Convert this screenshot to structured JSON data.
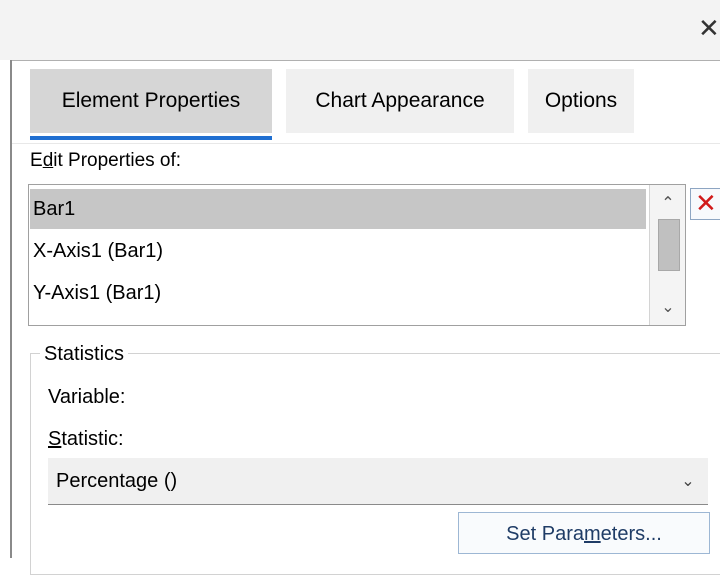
{
  "window": {
    "close_glyph": "✕"
  },
  "tabs": [
    {
      "label": "Element Properties",
      "active": true
    },
    {
      "label": "Chart Appearance",
      "active": false
    },
    {
      "label": "Options",
      "active": false
    }
  ],
  "edit_properties": {
    "label_prefix": "E",
    "label_mnemonic": "d",
    "label_suffix": "it Properties of:",
    "items": [
      {
        "label": "Bar1",
        "selected": true
      },
      {
        "label": "X-Axis1 (Bar1)",
        "selected": false
      },
      {
        "label": "Y-Axis1 (Bar1)",
        "selected": false
      }
    ],
    "delete_glyph": "✕"
  },
  "statistics": {
    "legend": "Statistics",
    "variable_label": "Variable:",
    "statistic_label_mnemonic": "S",
    "statistic_label_rest": "tatistic:",
    "statistic_value": "Percentage ()",
    "set_parameters_prefix": "Set Para",
    "set_parameters_mnemonic": "m",
    "set_parameters_suffix": "eters..."
  },
  "icons": {
    "close": "close-icon",
    "delete": "delete-icon",
    "scroll_up": "chevron-up-icon",
    "scroll_down": "chevron-down-icon",
    "dropdown": "chevron-down-icon"
  },
  "colors": {
    "active_tab_bg": "#d6d6d6",
    "tab_underline": "#1f6fd1",
    "selected_row": "#c6c6c6",
    "delete_x": "#d11a1a"
  }
}
